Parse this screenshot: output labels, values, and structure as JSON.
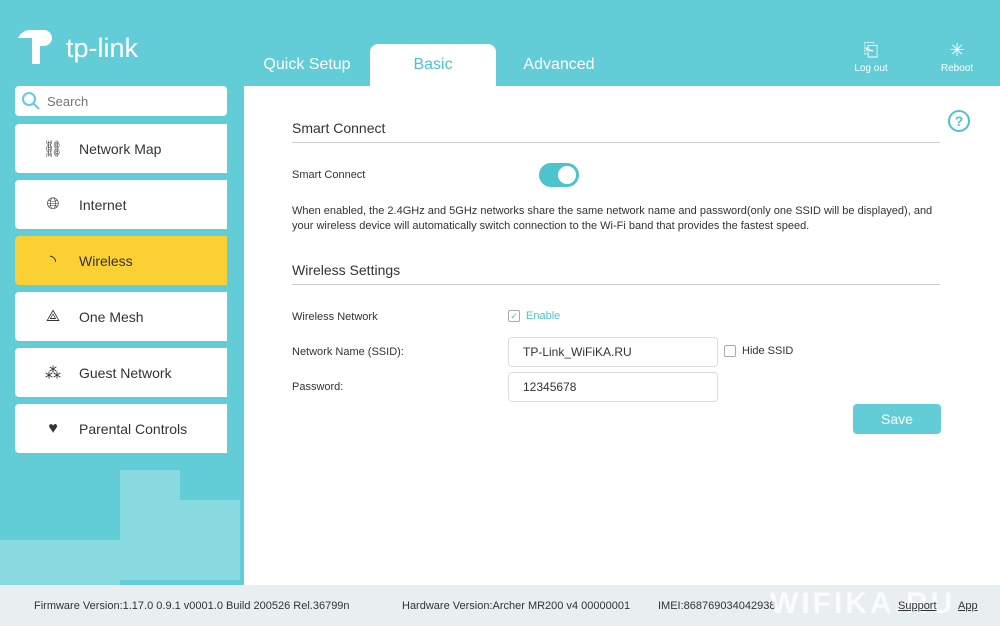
{
  "brand": {
    "name": "tp-link"
  },
  "tabs": [
    {
      "label": "Quick Setup"
    },
    {
      "label": "Basic"
    },
    {
      "label": "Advanced"
    }
  ],
  "top_buttons": {
    "logout": "Log out",
    "reboot": "Reboot"
  },
  "search": {
    "placeholder": "Search"
  },
  "sidebar": {
    "items": [
      {
        "label": "Network Map"
      },
      {
        "label": "Internet"
      },
      {
        "label": "Wireless"
      },
      {
        "label": "One Mesh"
      },
      {
        "label": "Guest Network"
      },
      {
        "label": "Parental Controls"
      }
    ]
  },
  "main": {
    "smart_connect_title": "Smart Connect",
    "smart_connect_label": "Smart Connect",
    "smart_connect_on": true,
    "description": "When enabled, the 2.4GHz and 5GHz networks share the same network name and password(only one SSID will be displayed), and your wireless device will automatically switch connection to the Wi-Fi band that provides the fastest speed.",
    "wireless_title": "Wireless Settings",
    "wireless_network_label": "Wireless Network",
    "enable_label": "Enable",
    "ssid_label": "Network Name (SSID):",
    "ssid_value": "TP-Link_WiFiKA.RU",
    "hide_ssid_label": "Hide SSID",
    "password_label": "Password:",
    "password_value": "12345678",
    "save_label": "Save"
  },
  "footer": {
    "firmware": "Firmware Version:1.17.0 0.9.1 v0001.0 Build 200526 Rel.36799n",
    "hardware": "Hardware Version:Archer MR200 v4 00000001",
    "imei": "IMEI:868769034042938",
    "support": "Support",
    "app": "App"
  },
  "watermark": "WIFIKA.RU",
  "colors": {
    "accent": "#62cdd6",
    "active": "#fbd033"
  }
}
